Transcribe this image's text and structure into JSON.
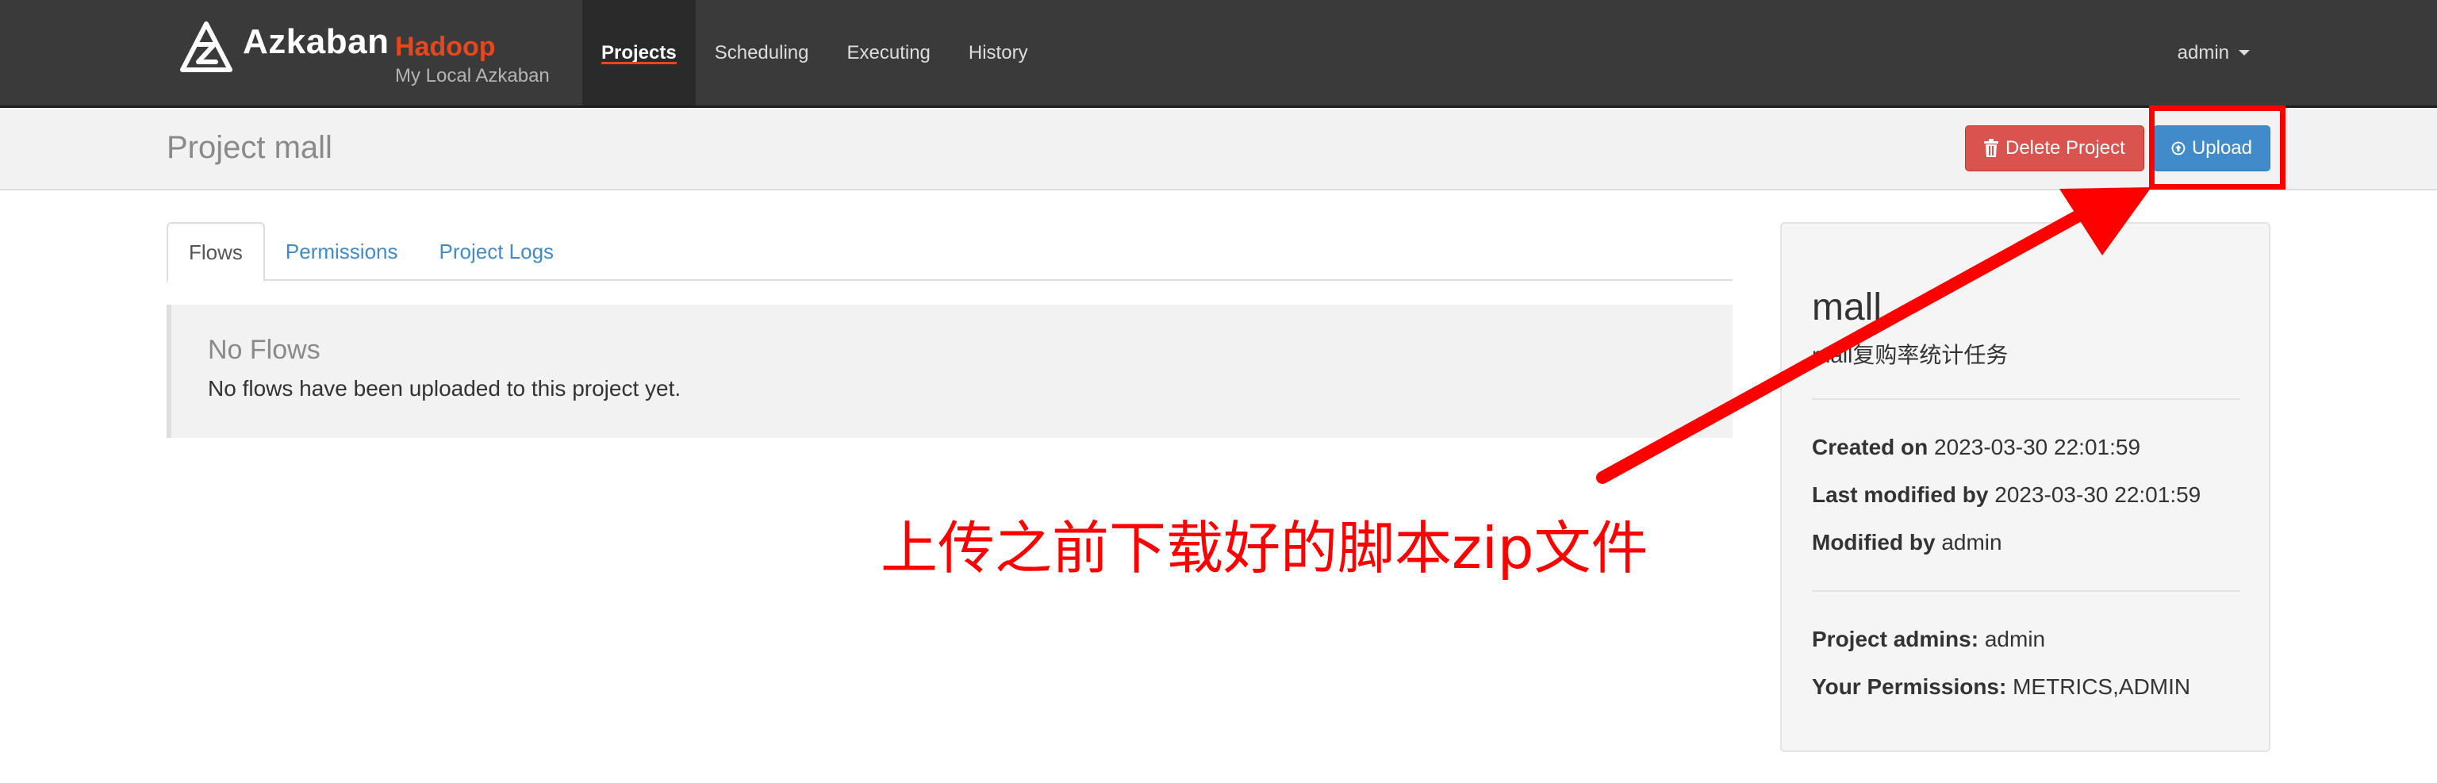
{
  "navbar": {
    "brand_name": "Azkaban",
    "brand_env": "Hadoop",
    "brand_subtitle": "My Local Azkaban",
    "items": [
      {
        "label": "Projects",
        "active": true
      },
      {
        "label": "Scheduling"
      },
      {
        "label": "Executing"
      },
      {
        "label": "History"
      }
    ],
    "user": "admin"
  },
  "header": {
    "title": "Project mall",
    "delete_label": "Delete Project",
    "upload_label": "Upload"
  },
  "tabs": [
    {
      "label": "Flows",
      "active": true
    },
    {
      "label": "Permissions"
    },
    {
      "label": "Project Logs"
    }
  ],
  "flows": {
    "empty_title": "No Flows",
    "empty_text": "No flows have been uploaded to this project yet."
  },
  "panel": {
    "name": "mall",
    "description": "mall复购率统计任务",
    "created_on_label": "Created on",
    "created_on": "2023-03-30 22:01:59",
    "last_modified_label": "Last modified by",
    "last_modified": "2023-03-30 22:01:59",
    "modified_by_label": "Modified by",
    "modified_by": "admin",
    "admins_label": "Project admins:",
    "admins": "admin",
    "permissions_label": "Your Permissions:",
    "permissions": "METRICS,ADMIN"
  },
  "annotation": {
    "text": "上传之前下载好的脚本zip文件"
  },
  "colors": {
    "navbar": "#3a3a3a",
    "brand_env": "#e8461c",
    "danger": "#d9534f",
    "primary": "#428bca",
    "annotation": "#ff0000"
  }
}
